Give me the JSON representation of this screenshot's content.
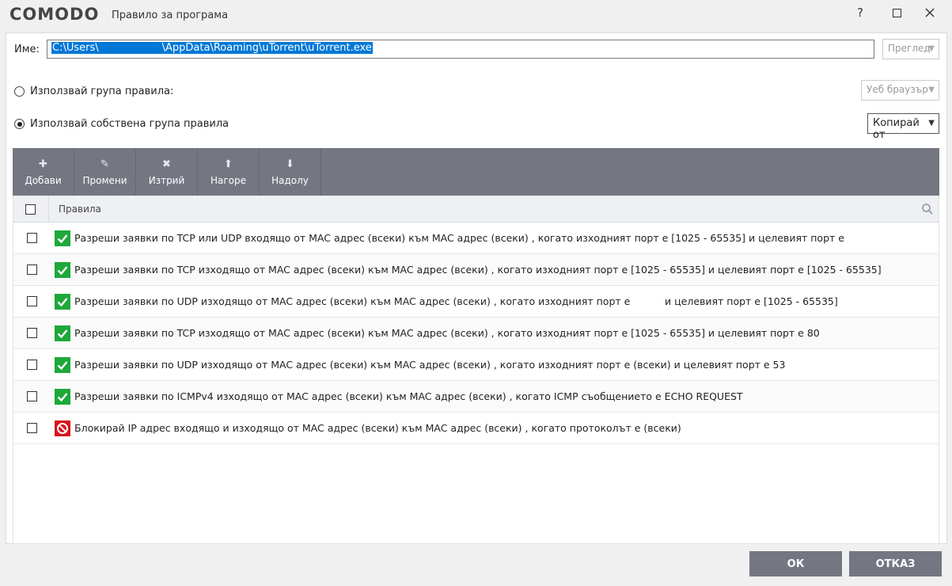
{
  "window": {
    "brand": "COMODO",
    "title": "Правило за програма",
    "help_label": "?"
  },
  "name_field": {
    "label": "Име:",
    "value_start": "C:\\Users\\",
    "value_end": "\\AppData\\Roaming\\uTorrent\\uTorrent.exe",
    "browse_label": "Преглед"
  },
  "ruleset": {
    "use_group_label": "Използвай група правила:",
    "group_dropdown": "Уеб браузър",
    "use_custom_label": "Използвай собствена група правила",
    "copy_dropdown": "Копирай от"
  },
  "toolbar": {
    "add": "Добави",
    "edit": "Промени",
    "delete": "Изтрий",
    "up": "Нагоре",
    "down": "Надолу"
  },
  "grid": {
    "header": "Правила",
    "rows": [
      {
        "status": "allow",
        "text": "Разреши заявки по TCP или UDP входящо от MAC адрес (всеки) към MAC адрес (всеки) , когато изходният порт е [1025 - 65535] и целевият порт е"
      },
      {
        "status": "allow",
        "text": "Разреши заявки по TCP изходящо от MAC адрес (всеки) към MAC адрес (всеки) , когато изходният порт е [1025 - 65535] и целевият порт е [1025 - 65535]"
      },
      {
        "status": "allow",
        "text": "Разреши заявки по UDP изходящо от MAC адрес (всеки) към MAC адрес (всеки) , когато изходният порт е           и целевият порт е [1025 - 65535]"
      },
      {
        "status": "allow",
        "text": "Разреши заявки по TCP изходящо от MAC адрес (всеки) към MAC адрес (всеки) , когато изходният порт е [1025 - 65535] и целевият порт е 80"
      },
      {
        "status": "allow",
        "text": "Разреши заявки по UDP изходящо от MAC адрес (всеки) към MAC адрес (всеки) , когато изходният порт е (всеки) и целевият порт е 53"
      },
      {
        "status": "allow",
        "text": "Разреши заявки по ICMPv4 изходящо от MAC адрес (всеки) към MAC адрес (всеки) , когато ICMP съобщението е ECHO REQUEST"
      },
      {
        "status": "block",
        "text": "Блокирай IP адрес входящо и изходящо от MAC адрес (всеки) към MAC адрес (всеки) , когато протоколът е (всеки)"
      }
    ]
  },
  "footer": {
    "ok": "ОК",
    "cancel": "ОТКАЗ"
  },
  "colors": {
    "toolbar": "#747782",
    "allow": "#1ea83a",
    "block": "#d7141e",
    "selection": "#0078d7"
  }
}
